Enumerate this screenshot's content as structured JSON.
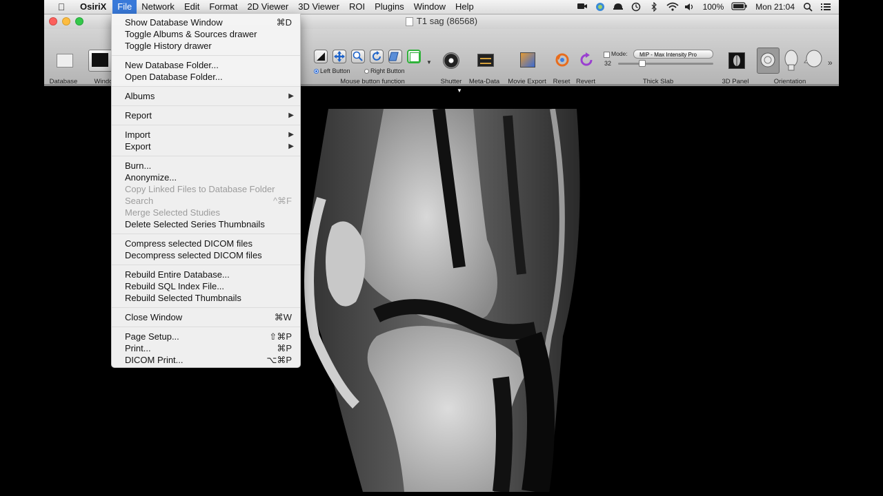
{
  "menubar": {
    "app_name": "OsiriX",
    "items": [
      "File",
      "Network",
      "Edit",
      "Format",
      "2D Viewer",
      "3D Viewer",
      "ROI",
      "Plugins",
      "Window",
      "Help"
    ],
    "active": "File",
    "battery": "100%",
    "clock": "Mon 21:04"
  },
  "window": {
    "title": "T1 sag (86568)"
  },
  "toolbar": {
    "labels": {
      "database": "Database",
      "window": "Windo",
      "mouse_function": "Mouse button function",
      "shutter": "Shutter",
      "metadata": "Meta-Data",
      "movie_export": "Movie Export",
      "reset": "Reset",
      "revert": "Revert",
      "thick_slab": "Thick Slab",
      "panel_3d": "3D Panel",
      "orientation": "Orientation"
    },
    "radio_left": "Left Button",
    "radio_right": "Right Button",
    "mode_label": "Mode:",
    "mode_value": "MIP - Max Intensity Pro",
    "slab_value": "32"
  },
  "file_menu": {
    "groups": [
      [
        {
          "label": "Show Database Window",
          "shortcut": "⌘D"
        },
        {
          "label": "Toggle Albums & Sources drawer",
          "shortcut": ""
        },
        {
          "label": "Toggle History drawer",
          "shortcut": ""
        }
      ],
      [
        {
          "label": "New Database Folder...",
          "shortcut": ""
        },
        {
          "label": "Open Database Folder...",
          "shortcut": ""
        }
      ],
      [
        {
          "label": "Albums",
          "submenu": true
        }
      ],
      [
        {
          "label": "Report",
          "submenu": true
        }
      ],
      [
        {
          "label": "Import",
          "submenu": true
        },
        {
          "label": "Export",
          "submenu": true
        }
      ],
      [
        {
          "label": "Burn...",
          "shortcut": ""
        },
        {
          "label": "Anonymize...",
          "shortcut": ""
        },
        {
          "label": "Copy Linked Files to Database Folder",
          "shortcut": "",
          "disabled": true
        },
        {
          "label": "Search",
          "shortcut": "^⌘F",
          "disabled": true
        },
        {
          "label": "Merge Selected Studies",
          "shortcut": "",
          "disabled": true
        },
        {
          "label": "Delete Selected Series Thumbnails",
          "shortcut": ""
        }
      ],
      [
        {
          "label": "Compress selected DICOM files",
          "shortcut": ""
        },
        {
          "label": "Decompress selected DICOM files",
          "shortcut": ""
        }
      ],
      [
        {
          "label": "Rebuild Entire Database...",
          "shortcut": ""
        },
        {
          "label": "Rebuild SQL Index File...",
          "shortcut": ""
        },
        {
          "label": "Rebuild Selected Thumbnails",
          "shortcut": ""
        }
      ],
      [
        {
          "label": "Close Window",
          "shortcut": "⌘W"
        }
      ],
      [
        {
          "label": "Page Setup...",
          "shortcut": "⇧⌘P"
        },
        {
          "label": "Print...",
          "shortcut": "⌘P"
        },
        {
          "label": "DICOM Print...",
          "shortcut": "⌥⌘P"
        }
      ]
    ]
  }
}
